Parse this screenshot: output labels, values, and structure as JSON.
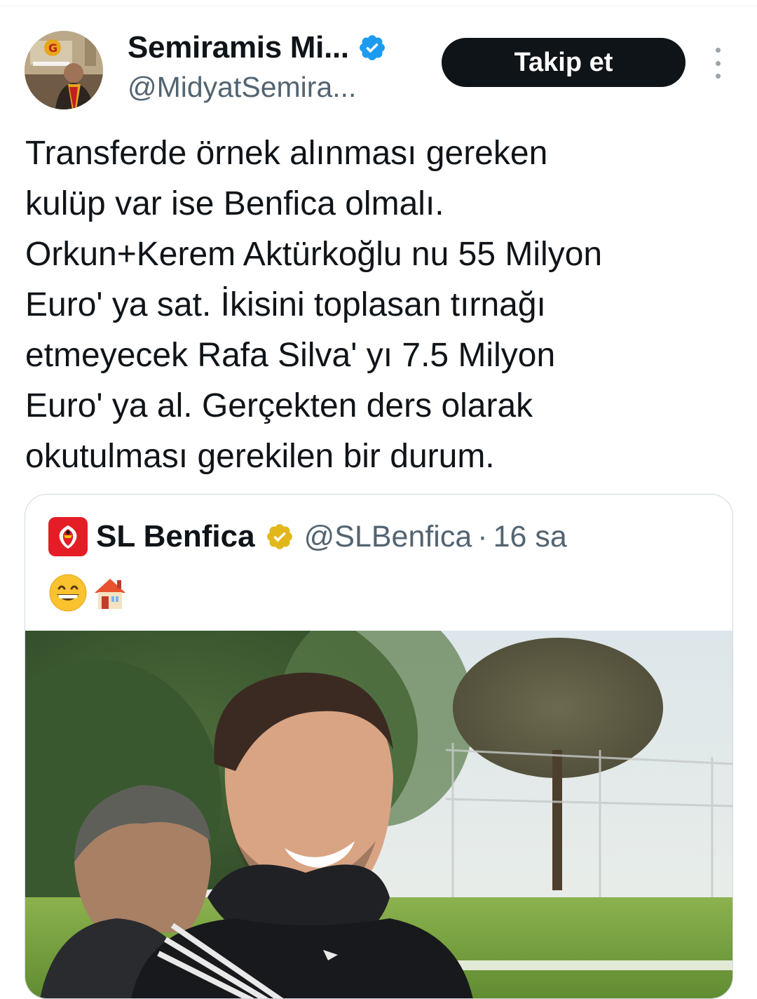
{
  "author": {
    "name": "Semiramis Mi...",
    "handle": "@MidyatSemira...",
    "avatar_icon": "profile-photo",
    "verified_color": "#1d9bf0"
  },
  "follow_button": {
    "label": "Takip et"
  },
  "more_icon": "more-vertical-icon",
  "tweet": {
    "lines": [
      "Transferde örnek alınması gereken",
      "kulüp var ise Benfica olmalı.",
      "Orkun+Kerem Aktürkoğlu nu 55 Milyon",
      "Euro' ya sat. İkisini toplasan tırnağı",
      "etmeyecek Rafa Silva' yı 7.5 Milyon",
      "Euro' ya al. Gerçekten ders olarak",
      "okutulması gerekilen bir durum."
    ]
  },
  "quoted": {
    "name": "SL Benfica",
    "handle": "@SLBenfica",
    "separator": "·",
    "time": "16 sa",
    "badge_color": "#e2b719",
    "logo_color": "#e41e26",
    "emojis": [
      "grinning-face-icon",
      "house-icon"
    ],
    "image": "player-photo"
  }
}
